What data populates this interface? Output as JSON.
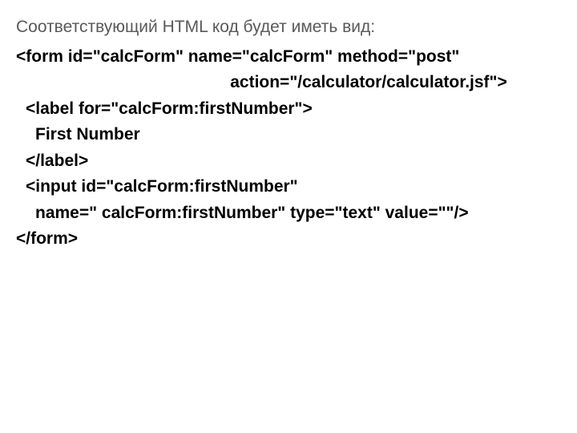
{
  "intro": "Соответствующий HTML код будет иметь вид:",
  "lines": {
    "l1": "<form id=\"calcForm\" name=\"calcForm\" method=\"post\"",
    "l2": "action=\"/calculator/calculator.jsf\">",
    "l3": "<label for=\"calcForm:firstNumber\">",
    "l4": "First Number",
    "l5": "</label>",
    "l6": "<input id=\"calcForm:firstNumber\"",
    "l7": "name=\" calcForm:firstNumber\" type=\"text\" value=\"\"/>",
    "l8": "</form>"
  }
}
